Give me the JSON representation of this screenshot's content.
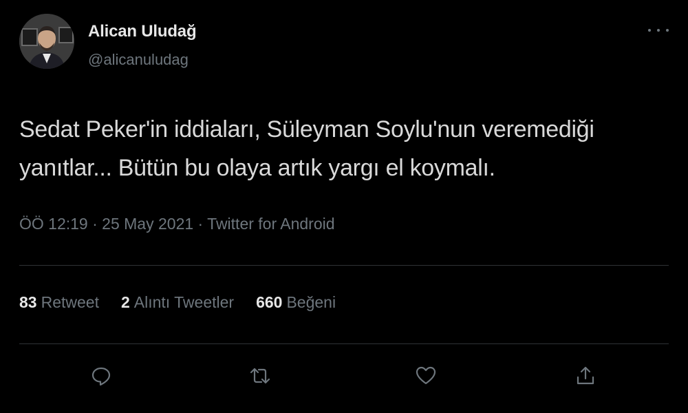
{
  "author": {
    "display_name": "Alican Uludağ",
    "handle": "@alicanuludag"
  },
  "tweet": {
    "line1": "Sedat Peker'in iddiaları, Süleyman Soylu'nun veremediği",
    "line2": "yanıtlar... Bütün bu olaya artık yargı el koymalı.",
    "timestamp": "ÖÖ 12:19 · 25 May 2021 · Twitter for Android"
  },
  "stats": {
    "retweets": {
      "count": "83",
      "label": "Retweet"
    },
    "quotes": {
      "count": "2",
      "label": "Alıntı Tweetler"
    },
    "likes": {
      "count": "660",
      "label": "Beğeni"
    }
  },
  "actions": {
    "reply_icon": "reply-icon",
    "retweet_icon": "retweet-icon",
    "like_icon": "heart-icon",
    "share_icon": "share-icon"
  },
  "colors": {
    "background": "#000000",
    "text": "#d9d9d9",
    "muted": "#6e767d",
    "divider": "#2f3336"
  }
}
